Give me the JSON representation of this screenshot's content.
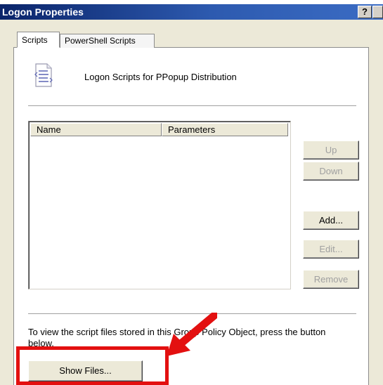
{
  "window": {
    "title": "Logon Properties",
    "help_label": "?",
    "close_label": ""
  },
  "tabs": [
    {
      "label": "Scripts",
      "active": true
    },
    {
      "label": "PowerShell Scripts",
      "active": false
    }
  ],
  "header": {
    "icon": "script-document-icon",
    "label": "Logon Scripts for PPopup Distribution"
  },
  "script_list": {
    "columns": [
      "Name",
      "Parameters"
    ],
    "rows": []
  },
  "buttons": {
    "up": "Up",
    "down": "Down",
    "add": "Add...",
    "edit": "Edit...",
    "remove": "Remove",
    "show_files": "Show Files..."
  },
  "hint_text": "To view the script files stored in this Group Policy Object, press the button below.",
  "annotation": {
    "color": "#e31010"
  }
}
